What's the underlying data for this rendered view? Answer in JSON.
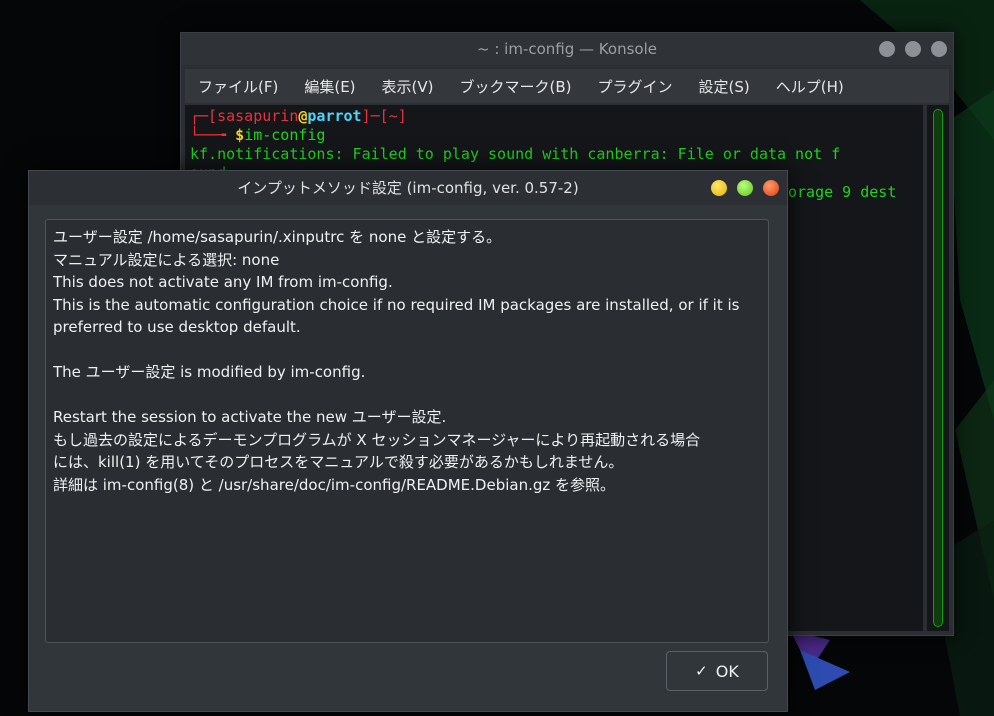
{
  "konsole": {
    "title": "~ : im-config — Konsole",
    "menu": [
      "ファイル(F)",
      "編集(E)",
      "表示(V)",
      "ブックマーク(B)",
      "プラグイン",
      "設定(S)",
      "ヘルプ(H)"
    ],
    "prompt_user": "sasapurin",
    "prompt_at": "@",
    "prompt_host": "parrot",
    "prompt_dir": "~",
    "command": "im-config",
    "output_line1": "kf.notifications: Failed to play sound with canberra: File or data not f",
    "output_line2": "ound",
    "output_line3_visible": "orage 9 dest"
  },
  "dialog": {
    "title": "インプットメソッド設定 (im-config, ver. 0.57-2)",
    "message": [
      "ユーザー設定 /home/sasapurin/.xinputrc を none と設定する。",
      "マニュアル設定による選択: none",
      "This does not activate any IM from im-config.",
      "This is the automatic configuration choice if no required IM packages are installed, or if it is",
      "preferred to use desktop default.",
      "",
      "The ユーザー設定 is modified by im-config.",
      "",
      "Restart the session to activate the new ユーザー設定.",
      "もし過去の設定によるデーモンプログラムが X セッションマネージャーにより再起動される場合",
      "には、kill(1) を用いてそのプロセスをマニュアルで殺す必要があるかもしれません。",
      "詳細は im-config(8) と /usr/share/doc/im-config/README.Debian.gz を参照。"
    ],
    "ok_label": "OK"
  },
  "colors": {
    "terminal_green": "#1fd31f",
    "prompt_red": "#e7333a",
    "prompt_yellow": "#f6d31a",
    "prompt_cyan": "#4fd3f7"
  }
}
